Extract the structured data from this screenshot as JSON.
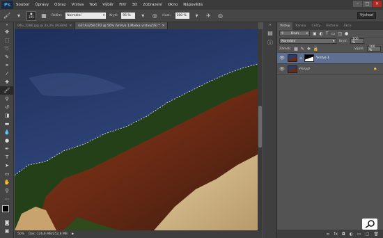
{
  "app": {
    "logo": "Ps"
  },
  "menu": [
    "Soubor",
    "Úpravy",
    "Obraz",
    "Vrstva",
    "Text",
    "Výběr",
    "Filtr",
    "3D",
    "Zobrazení",
    "Okno",
    "Nápověda"
  ],
  "window_controls": {
    "minimize": "–",
    "maximize": "□",
    "close": "✕"
  },
  "options": {
    "brush_size": "205",
    "mode_label": "Režim:",
    "mode_value": "Normální",
    "opacity_label": "Krytí:",
    "opacity_value": "95 %",
    "flow_label": "Hust.:",
    "flow_value": "100 %",
    "workspace": "Výchozí"
  },
  "doc_tabs": [
    {
      "label": "IMG_3286.jpg @ 33,3% (RGB/8)",
      "active": false
    },
    {
      "label": "GE7A3258.CR2 @ 50% (Vrstva 1,Maska vrstvy/16) *",
      "active": true
    }
  ],
  "status": {
    "zoom": "50%",
    "doc_info": "Dok: 126,6 MB/252,8 MB"
  },
  "layers_panel": {
    "tabs": [
      "Vrstvy",
      "Kanály",
      "Cesty",
      "Historie",
      "Akce"
    ],
    "filter_label": "Druh",
    "blend_mode": "Normální",
    "opacity_label": "Krytí:",
    "opacity_value": "100 %",
    "lock_label": "Zámek:",
    "fill_label": "Výplň:",
    "fill_value": "100 %",
    "layers": [
      {
        "name": "Vrstva 1",
        "selected": true
      },
      {
        "name": "Pozadí",
        "selected": false
      }
    ]
  },
  "icons": {
    "eye": "eye-icon",
    "lock": "lock-icon",
    "link": "link-icon",
    "close": "close-icon"
  }
}
